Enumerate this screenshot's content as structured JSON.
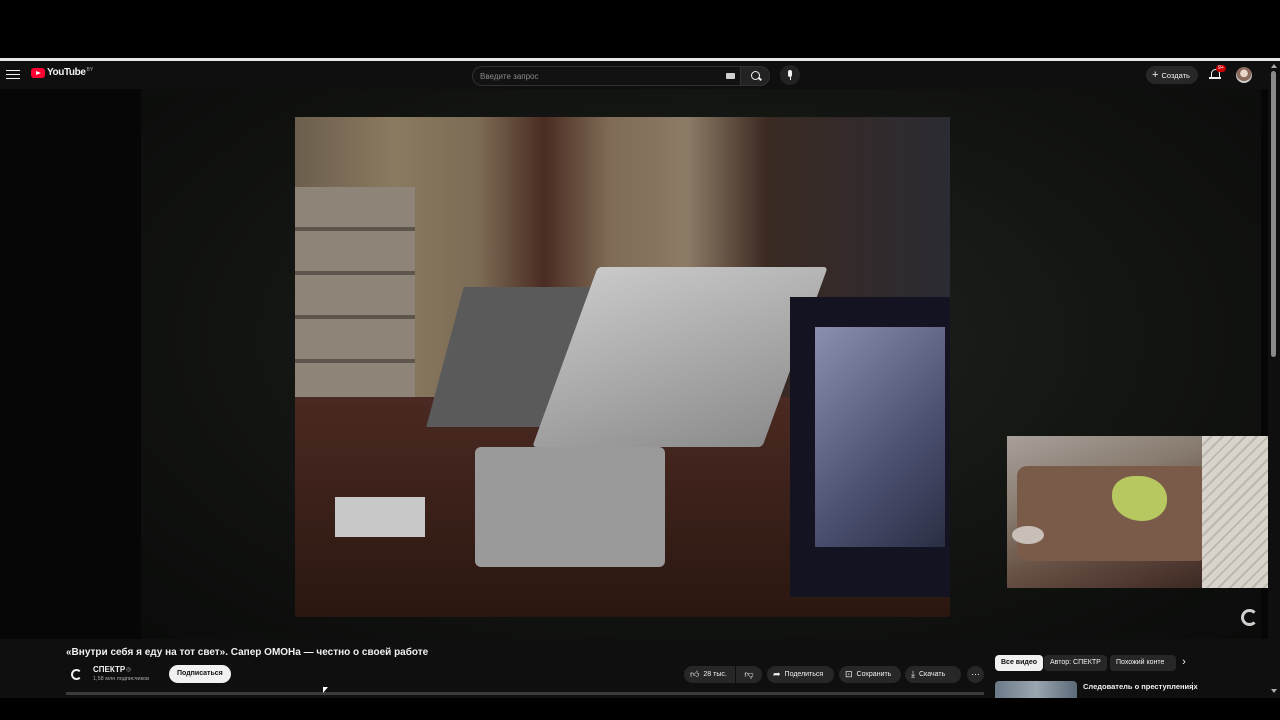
{
  "header": {
    "logo_text": "YouTube",
    "country_code": "BY",
    "search_placeholder": "Введите запрос",
    "create_label": "Создать",
    "notifications_badge": "9+"
  },
  "video": {
    "title": "«Внутри себя я еду на тот свет». Сапер ОМОНа — честно о своей работе",
    "channel_name": "СПЕКТР",
    "channel_subscribers": "1,58 млн подписчиков",
    "subscribe_label": "Подписаться",
    "likes_label": "28 тыс.",
    "share_label": "Поделиться",
    "save_label": "Сохранить",
    "download_label": "Скачать"
  },
  "sidebar": {
    "chips": [
      "Все видео",
      "Автор: СПЕКТР",
      "Похожий конте"
    ],
    "active_chip": "Все видео",
    "recommendation_title": "Следователь о преступлениях"
  },
  "colors": {
    "background": "#0f0f0f",
    "brand_red": "#ff0033",
    "chip_bg": "#272727",
    "text": "#f1f1f1"
  },
  "icons": [
    "menu-icon",
    "youtube-logo-icon",
    "keyboard-icon",
    "search-icon",
    "microphone-icon",
    "plus-icon",
    "bell-icon",
    "avatar",
    "like-icon",
    "dislike-icon",
    "share-icon",
    "save-icon",
    "download-icon",
    "more-icon",
    "chevron-right-icon",
    "loading-spinner-icon"
  ]
}
